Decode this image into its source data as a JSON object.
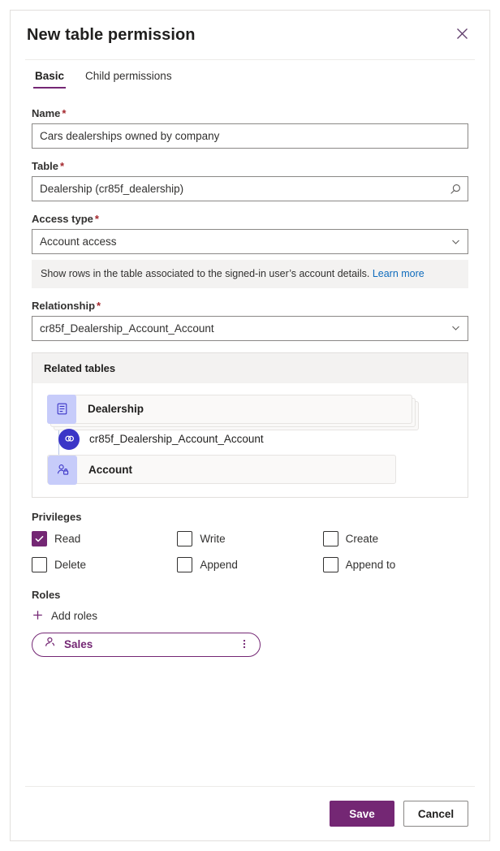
{
  "dialog": {
    "title": "New table permission",
    "close_icon": "close-icon"
  },
  "tabs": [
    {
      "label": "Basic",
      "active": true
    },
    {
      "label": "Child permissions",
      "active": false
    }
  ],
  "form": {
    "name": {
      "label": "Name",
      "required": "*",
      "value": "Cars dealerships owned by company"
    },
    "table": {
      "label": "Table",
      "required": "*",
      "value": "Dealership (cr85f_dealership)",
      "icon": "search-icon"
    },
    "access_type": {
      "label": "Access type",
      "required": "*",
      "value": "Account access",
      "icon": "chevron-down-icon",
      "hint_text": "Show rows in the table associated to the signed-in user’s account details.",
      "hint_link": "Learn more"
    },
    "relationship": {
      "label": "Relationship",
      "required": "*",
      "value": "cr85f_Dealership_Account_Account",
      "icon": "chevron-down-icon"
    }
  },
  "related_tables": {
    "header": "Related tables",
    "source_table": "Dealership",
    "source_icon": "table-icon",
    "relationship_name": "cr85f_Dealership_Account_Account",
    "relationship_icon": "link-icon",
    "target_table": "Account",
    "target_icon": "account-user-icon"
  },
  "privileges": {
    "label": "Privileges",
    "items": [
      {
        "label": "Read",
        "checked": true
      },
      {
        "label": "Write",
        "checked": false
      },
      {
        "label": "Create",
        "checked": false
      },
      {
        "label": "Delete",
        "checked": false
      },
      {
        "label": "Append",
        "checked": false
      },
      {
        "label": "Append to",
        "checked": false
      }
    ]
  },
  "roles": {
    "label": "Roles",
    "add_label": "Add roles",
    "add_icon": "plus-icon",
    "chips": [
      {
        "name": "Sales",
        "icon": "role-person-icon",
        "menu_icon": "more-vertical-icon"
      }
    ]
  },
  "footer": {
    "save_label": "Save",
    "cancel_label": "Cancel"
  },
  "colors": {
    "accent_purple": "#742774",
    "link_blue": "#0f6cbd",
    "node_blue": "#3b35c7",
    "tile_blue": "#c7ccfa",
    "required_red": "#a4262c"
  }
}
